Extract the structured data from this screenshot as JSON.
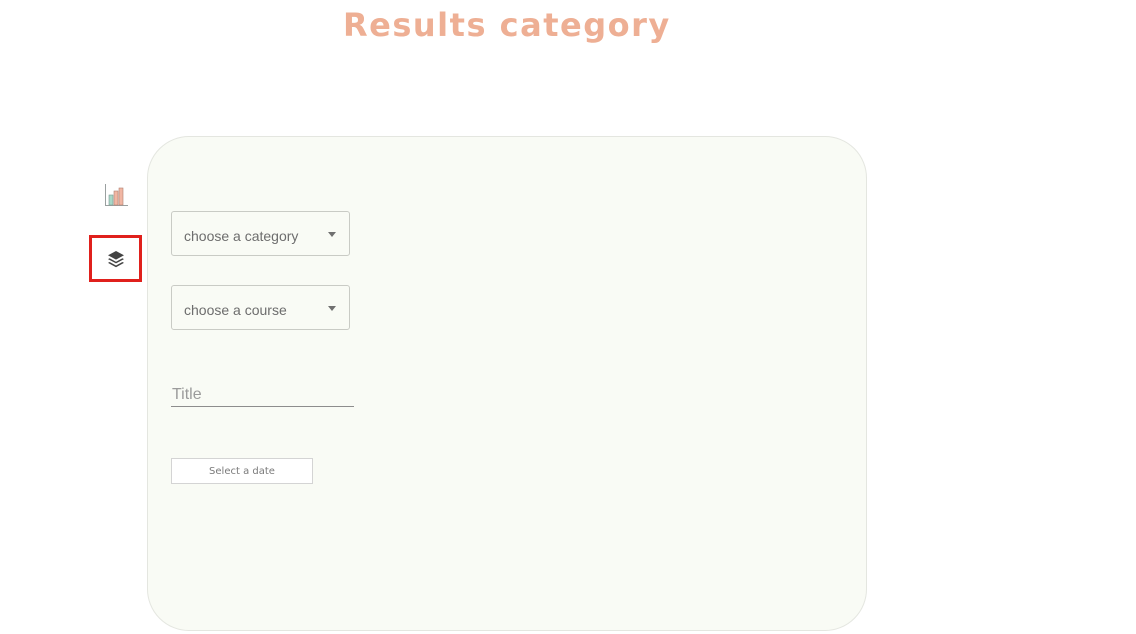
{
  "header": {
    "title": "Results category"
  },
  "sidebar": {
    "icons": [
      {
        "name": "bar-chart-icon",
        "active": false
      },
      {
        "name": "layers-icon",
        "active": true,
        "highlight_color": "#e0201c"
      }
    ]
  },
  "form": {
    "category_select": {
      "value": "choose a category"
    },
    "course_select": {
      "value": "choose a course"
    },
    "title_input": {
      "placeholder": "Title",
      "value": ""
    },
    "date_button": {
      "label": "Select a date"
    }
  },
  "colors": {
    "title": "#eeaf94",
    "panel_background": "#f9fbf5",
    "highlight": "#e0201c"
  }
}
